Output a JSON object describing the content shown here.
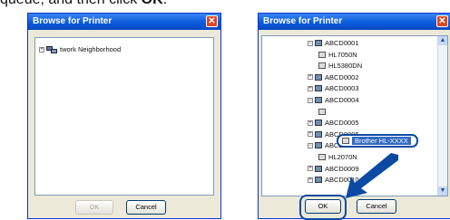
{
  "instruction": {
    "prefix": "queue, and then click ",
    "bold": "OK",
    "suffix": "."
  },
  "left_dialog": {
    "title": "Browse for Printer",
    "tree_item": "twork Neighborhood",
    "ok_label": "OK",
    "cancel_label": "Cancel"
  },
  "right_dialog": {
    "title": "Browse for Printer",
    "items": [
      {
        "label": "ABCD0001",
        "level": 0,
        "expander": "−",
        "icon": "computer-icon"
      },
      {
        "label": "HL7050N",
        "level": 1,
        "icon": "printer-icon"
      },
      {
        "label": "HL5380DN",
        "level": 1,
        "icon": "printer-icon"
      },
      {
        "label": "ABCD0002",
        "level": 0,
        "expander": "+",
        "icon": "computer-icon"
      },
      {
        "label": "ABCD0003",
        "level": 0,
        "expander": "+",
        "icon": "computer-icon"
      },
      {
        "label": "ABCD0004",
        "level": 0,
        "expander": "−",
        "icon": "computer-icon"
      },
      {
        "label": "",
        "level": 1,
        "icon": "printer-icon"
      },
      {
        "label": "ABCD0005",
        "level": 0,
        "expander": "+",
        "icon": "computer-icon"
      },
      {
        "label": "ABCD0006",
        "level": 0,
        "expander": "+",
        "icon": "computer-icon"
      },
      {
        "label": "ABCD0007",
        "level": 0,
        "expander": "−",
        "icon": "computer-icon"
      },
      {
        "label": "HL2070N",
        "level": 1,
        "icon": "printer-icon"
      },
      {
        "label": "ABCD0009",
        "level": 0,
        "expander": "+",
        "icon": "computer-icon"
      },
      {
        "label": "ABCD0010",
        "level": 0,
        "expander": "+",
        "icon": "computer-icon"
      }
    ],
    "selected_printer": "Brother HL-XXXX",
    "ok_label": "OK",
    "cancel_label": "Cancel"
  },
  "colors": {
    "titlebar": "#0a5bdc",
    "selection": "#316ac5",
    "callout": "#0a4aa3"
  }
}
